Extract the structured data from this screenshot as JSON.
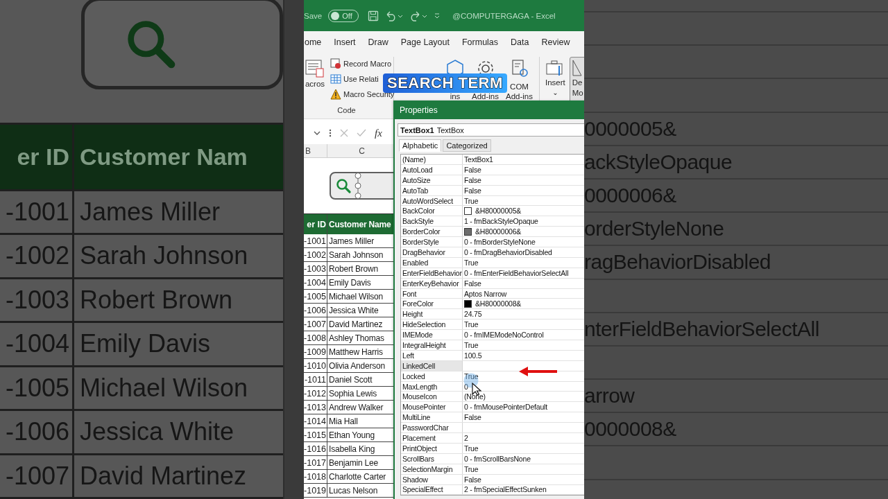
{
  "left_backdrop": {
    "columns": [
      "er ID",
      "Customer Nam"
    ],
    "rows": [
      [
        "-1001",
        "James Miller"
      ],
      [
        "-1002",
        "Sarah Johnson"
      ],
      [
        "-1003",
        "Robert Brown"
      ],
      [
        "-1004",
        "Emily Davis"
      ],
      [
        "-1005",
        "Michael Wilson"
      ],
      [
        "-1006",
        "Jessica White"
      ],
      [
        "-1007",
        "David Martinez"
      ]
    ]
  },
  "title_bar": {
    "autosave_label": "Save",
    "toggle": {
      "label": "Off",
      "on": false
    },
    "title": "@COMPUTERGAGA  -  Excel"
  },
  "tabs": [
    {
      "label": "ome",
      "selected": false
    },
    {
      "label": "Insert",
      "selected": false
    },
    {
      "label": "Draw",
      "selected": false
    },
    {
      "label": "Page Layout",
      "selected": false
    },
    {
      "label": "Formulas",
      "selected": false
    },
    {
      "label": "Data",
      "selected": false
    },
    {
      "label": "Review",
      "selected": false
    }
  ],
  "ribbon": {
    "macros_label": "acros",
    "code_commands": [
      {
        "kind": "record",
        "label": "Record Macro"
      },
      {
        "kind": "relative",
        "label": "Use Relati"
      },
      {
        "kind": "security",
        "label": "Macro Security"
      }
    ],
    "code_group": "Code",
    "addins": [
      {
        "kind": "hexagon",
        "lines": [
          "ins"
        ]
      },
      {
        "kind": "gear",
        "lines": [
          "Add-ins"
        ]
      },
      {
        "kind": "com",
        "lines": [
          "COM",
          "Add-ins"
        ]
      }
    ],
    "insert": {
      "label": "Insert",
      "caret": "⌄"
    },
    "design_mode": {
      "lines": [
        "De",
        "Mo"
      ],
      "on": true
    }
  },
  "caption": "SEARCH TERM",
  "formula_bar": {
    "fx": "fx"
  },
  "sheet": {
    "column_headers": [
      "B",
      "C"
    ],
    "header": [
      "er ID",
      "Customer Name"
    ],
    "rows": [
      [
        "-1001",
        "James Miller"
      ],
      [
        "-1002",
        "Sarah Johnson"
      ],
      [
        "-1003",
        "Robert Brown"
      ],
      [
        "-1004",
        "Emily Davis"
      ],
      [
        "-1005",
        "Michael Wilson"
      ],
      [
        "-1006",
        "Jessica White"
      ],
      [
        "-1007",
        "David Martinez"
      ],
      [
        "-1008",
        "Ashley Thomas"
      ],
      [
        "-1009",
        "Matthew Harris"
      ],
      [
        "-1010",
        "Olivia Anderson"
      ],
      [
        "-1011",
        "Daniel Scott"
      ],
      [
        "-1012",
        "Sophia Lewis"
      ],
      [
        "-1013",
        "Andrew Walker"
      ],
      [
        "-1014",
        "Mia Hall"
      ],
      [
        "-1015",
        "Ethan Young"
      ],
      [
        "-1016",
        "Isabella King"
      ],
      [
        "-1017",
        "Benjamin Lee"
      ],
      [
        "-1018",
        "Charlotte Carter"
      ],
      [
        "-1019",
        "Lucas Nelson"
      ]
    ]
  },
  "properties": {
    "title": "Properties",
    "object_name": "TextBox1",
    "object_type": "TextBox",
    "tabs": [
      {
        "label": "Alphabetic",
        "selected": true
      },
      {
        "label": "Categorized",
        "selected": false
      }
    ],
    "rows": [
      {
        "name": "(Name)",
        "value": "TextBox1",
        "selected": false
      },
      {
        "name": "AutoLoad",
        "value": "False",
        "selected": false
      },
      {
        "name": "AutoSize",
        "value": "False",
        "selected": false
      },
      {
        "name": "AutoTab",
        "value": "False",
        "selected": false
      },
      {
        "name": "AutoWordSelect",
        "value": "True",
        "selected": false
      },
      {
        "name": "BackColor",
        "value": "&H80000005&",
        "color": "#ffffff",
        "selected": false
      },
      {
        "name": "BackStyle",
        "value": "1 - fmBackStyleOpaque",
        "selected": false
      },
      {
        "name": "BorderColor",
        "value": "&H80000006&",
        "color": "#6d6d6d",
        "selected": false
      },
      {
        "name": "BorderStyle",
        "value": "0 - fmBorderStyleNone",
        "selected": false
      },
      {
        "name": "DragBehavior",
        "value": "0 - fmDragBehaviorDisabled",
        "selected": false
      },
      {
        "name": "Enabled",
        "value": "True",
        "selected": false
      },
      {
        "name": "EnterFieldBehavior",
        "value": "0 - fmEnterFieldBehaviorSelectAll",
        "selected": false
      },
      {
        "name": "EnterKeyBehavior",
        "value": "False",
        "selected": false
      },
      {
        "name": "Font",
        "value": "Aptos Narrow",
        "selected": false
      },
      {
        "name": "ForeColor",
        "value": "&H80000008&",
        "color": "#000000",
        "selected": false
      },
      {
        "name": "Height",
        "value": "24.75",
        "selected": false
      },
      {
        "name": "HideSelection",
        "value": "True",
        "selected": false
      },
      {
        "name": "IMEMode",
        "value": "0 - fmIMEModeNoControl",
        "selected": false
      },
      {
        "name": "IntegralHeight",
        "value": "True",
        "selected": false
      },
      {
        "name": "Left",
        "value": "100.5",
        "selected": false
      },
      {
        "name": "LinkedCell",
        "selected": true
      },
      {
        "name": "Locked",
        "value": "True",
        "selected": false
      },
      {
        "name": "MaxLength",
        "value": "0",
        "selected": false
      },
      {
        "name": "MouseIcon",
        "value": "(None)",
        "selected": false
      },
      {
        "name": "MousePointer",
        "value": "0 - fmMousePointerDefault",
        "selected": false
      },
      {
        "name": "MultiLine",
        "value": "False",
        "selected": false
      },
      {
        "name": "PasswordChar",
        "selected": false
      },
      {
        "name": "Placement",
        "value": "2",
        "selected": false
      },
      {
        "name": "PrintObject",
        "value": "True",
        "selected": false
      },
      {
        "name": "ScrollBars",
        "value": "0 - fmScrollBarsNone",
        "selected": false
      },
      {
        "name": "SelectionMargin",
        "value": "True",
        "selected": false
      },
      {
        "name": "Shadow",
        "value": "False",
        "selected": false
      },
      {
        "name": "SpecialEffect",
        "value": "2 - fmSpecialEffectSunken",
        "selected": false
      }
    ]
  },
  "right_backdrop": {
    "rows": [
      {},
      {},
      {},
      {
        "value": "0000005&"
      },
      {
        "value": "ackStyleOpaque"
      },
      {
        "value": "0000006&"
      },
      {
        "value": "orderStyleNone"
      },
      {
        "value": "ragBehaviorDisabled"
      },
      {},
      {
        "value": "nterFieldBehaviorSelectAll"
      },
      {},
      {
        "value": "arrow"
      },
      {
        "value": "0000008&"
      },
      {},
      {}
    ]
  }
}
